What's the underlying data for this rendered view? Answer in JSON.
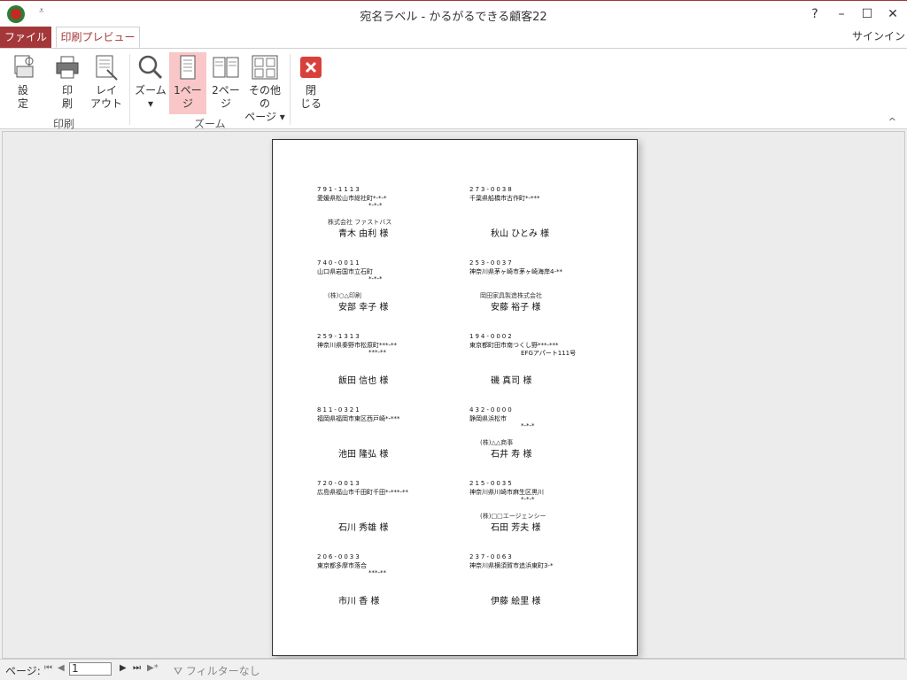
{
  "window": {
    "title": "宛名ラベル - かるがるできる顧客22",
    "qat_glyph": "⩡",
    "controls": [
      "?",
      "–",
      "☐",
      "✕"
    ]
  },
  "tabs": {
    "file": "ファイル",
    "preview": "印刷プレビュー",
    "signin": "サインイン"
  },
  "ribbon": {
    "buttons": {
      "settings": "設\n定",
      "print": "印\n刷",
      "layout": "レイ\nアウト",
      "zoom": "ズーム\n▾",
      "one_page": "1ペー\nジ",
      "two_page": "2ペー\nジ",
      "other_pages": "その他の\nページ ▾",
      "close": "閉\nじる"
    },
    "groups": {
      "print": "印刷",
      "zoom": "ズーム"
    },
    "collapse": "^"
  },
  "labels": [
    {
      "zip": "791-1113",
      "addr1": "愛媛県松山市総社町*-*-*",
      "addr2": "*-*-*",
      "company": "株式会社 ファストバス",
      "name": "青木 由利 様"
    },
    {
      "zip": "273-0038",
      "addr1": "千葉県船橋市古作町*-***",
      "addr2": "",
      "company": "",
      "name": "秋山 ひとみ 様"
    },
    {
      "zip": "740-0011",
      "addr1": "山口県岩国市立石町",
      "addr2": "*-*-*",
      "company": "(株)○△印刷",
      "name": "安部 幸子 様"
    },
    {
      "zip": "253-0037",
      "addr1": "神奈川県茅ヶ崎市茅ヶ崎海岸4-**",
      "addr2": "",
      "company": "岡田家具製造株式会社",
      "name": "安藤 裕子 様"
    },
    {
      "zip": "259-1313",
      "addr1": "神奈川県秦野市松原町***-**",
      "addr2": "***-**",
      "company": "",
      "name": "飯田 信也 様"
    },
    {
      "zip": "194-0002",
      "addr1": "東京都町田市南つくし野***-***",
      "addr2": "EFGアパート111号",
      "company": "",
      "name": "磯 真司 様"
    },
    {
      "zip": "811-0321",
      "addr1": "福岡県福岡市東区西戸崎*-***",
      "addr2": "",
      "company": "",
      "name": "池田 隆弘 様"
    },
    {
      "zip": "432-0000",
      "addr1": "静岡県浜松市",
      "addr2": "*-*-*",
      "company": "(株)△△商事",
      "name": "石井 寿 様"
    },
    {
      "zip": "720-0013",
      "addr1": "広島県福山市千田町千田*-***-**",
      "addr2": "",
      "company": "",
      "name": "石川 秀雄 様"
    },
    {
      "zip": "215-0035",
      "addr1": "神奈川県川崎市麻生区黒川",
      "addr2": "*-*-*",
      "company": "(株)□□エージェンシー",
      "name": "石田 芳夫 様"
    },
    {
      "zip": "206-0033",
      "addr1": "東京都多摩市落合",
      "addr2": "***-**",
      "company": "",
      "name": "市川 香 様"
    },
    {
      "zip": "237-0063",
      "addr1": "神奈川県横須賀市追浜東町3-*",
      "addr2": "",
      "company": "",
      "name": "伊藤 絵里 様"
    }
  ],
  "status": {
    "page_label": "ページ:",
    "page_value": "1",
    "filter": "フィルターなし"
  }
}
